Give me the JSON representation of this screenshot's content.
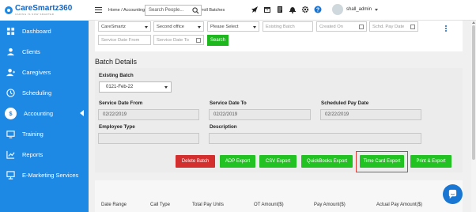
{
  "app": {
    "logo_name": "CareSmartz360",
    "logo_tagline": "CARING IS NOW SMARTER"
  },
  "sidebar": {
    "items": [
      {
        "label": "Dashboard",
        "icon": "dashboard-icon"
      },
      {
        "label": "Clients",
        "icon": "person-icon"
      },
      {
        "label": "Caregivers",
        "icon": "caregiver-icon"
      },
      {
        "label": "Scheduling",
        "icon": "clock-icon"
      },
      {
        "label": "Accounting",
        "icon": "dollar-icon",
        "active": true
      },
      {
        "label": "Training",
        "icon": "training-icon"
      },
      {
        "label": "Reports",
        "icon": "chart-icon"
      },
      {
        "label": "E-Marketing Services",
        "icon": "presentation-icon"
      }
    ]
  },
  "header": {
    "breadcrumb": "Home / Accounting / Payroll / View Finalized Payroll Batches",
    "search_placeholder": "Search People...",
    "user_name": "shall_admin"
  },
  "filters": {
    "agency": "CareSmartz",
    "office": "Second office",
    "select": "Please Select",
    "existing_batch_placeholder": "Existing Batch",
    "created_on_placeholder": "Created On",
    "schd_pay_date_placeholder": "Schd. Pay Date",
    "service_date_from_placeholder": "Service Date From",
    "service_date_to_placeholder": "Service Date To",
    "search_button": "Search"
  },
  "batch_details": {
    "title": "Batch Details",
    "existing_batch_label": "Existing Batch",
    "existing_batch_value": "0121-Feb-22",
    "service_date_from_label": "Service Date From",
    "service_date_from_value": "02/22/2019",
    "service_date_to_label": "Service Date To",
    "service_date_to_value": "02/22/2019",
    "scheduled_pay_date_label": "Scheduled Pay Date",
    "scheduled_pay_date_value": "02/22/2019",
    "employee_type_label": "Employee Type",
    "description_label": "Description"
  },
  "actions": {
    "delete_batch": "Delete Batch",
    "adp_export": "ADP Export",
    "csv_export": "CSV Export",
    "quickbooks_export": "QuickBooks Export",
    "time_card_export": "Time Card Export",
    "print_export": "Print & Export"
  },
  "table": {
    "columns": [
      "Date Range",
      "Call Type",
      "Total Pay Units",
      "OT Amount($)",
      "Pay Amount($)",
      "Actual Pay Amount($)"
    ]
  },
  "colors": {
    "sidebar": "#1e88e5",
    "green_button": "#22c222",
    "red_button": "#d32f2f",
    "highlight": "#e53935"
  }
}
